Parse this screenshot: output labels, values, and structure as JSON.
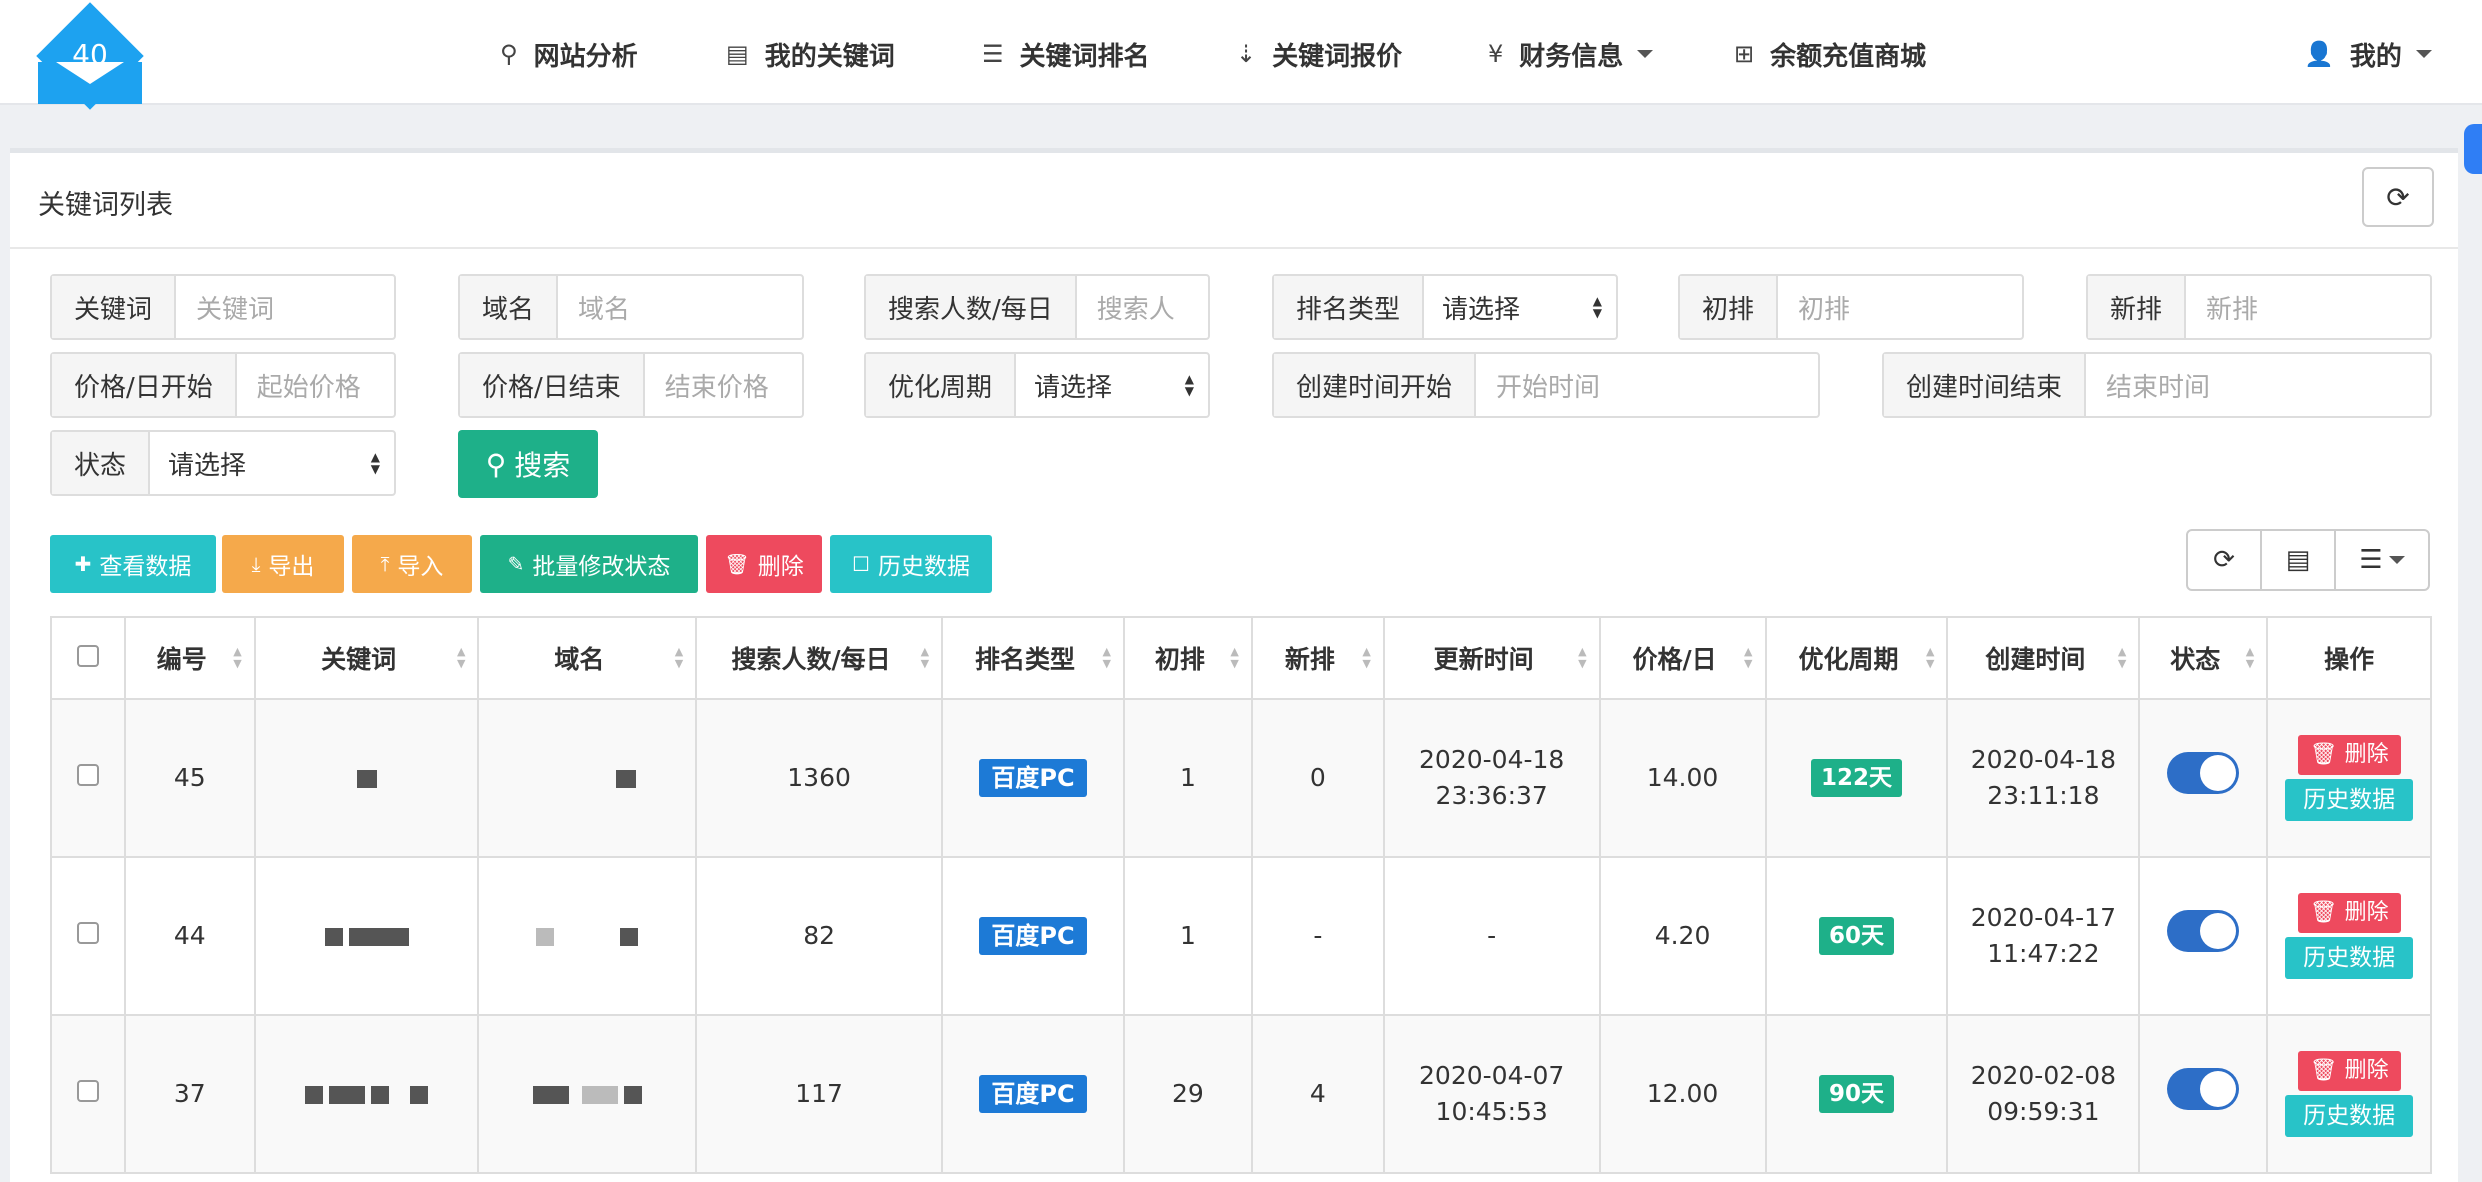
{
  "logo": {
    "badge": "40"
  },
  "nav": {
    "items": [
      {
        "icon": "search-icon",
        "glyph": "⚲",
        "label": "网站分析"
      },
      {
        "icon": "list-alt-icon",
        "glyph": "▤",
        "label": "我的关键词"
      },
      {
        "icon": "list-ol-icon",
        "glyph": "☰",
        "label": "关键词排名"
      },
      {
        "icon": "sort-numeric-icon",
        "glyph": "⇣",
        "label": "关键词报价"
      },
      {
        "icon": "yen-icon",
        "glyph": "¥",
        "label": "财务信息"
      },
      {
        "icon": "plus-square-icon",
        "glyph": "⊞",
        "label": "余额充值商城"
      }
    ],
    "user_label": "我的"
  },
  "panel": {
    "title": "关键词列表"
  },
  "filters": {
    "keyword": {
      "label": "关键词",
      "placeholder": "关键词"
    },
    "domain": {
      "label": "域名",
      "placeholder": "域名"
    },
    "searches": {
      "label": "搜索人数/每日",
      "placeholder": "搜索人"
    },
    "rank_type": {
      "label": "排名类型",
      "value": "请选择"
    },
    "first_rank": {
      "label": "初排",
      "placeholder": "初排"
    },
    "new_rank": {
      "label": "新排",
      "placeholder": "新排"
    },
    "price_start": {
      "label": "价格/日开始",
      "placeholder": "起始价格"
    },
    "price_end": {
      "label": "价格/日结束",
      "placeholder": "结束价格"
    },
    "period": {
      "label": "优化周期",
      "value": "请选择"
    },
    "created_start": {
      "label": "创建时间开始",
      "placeholder": "开始时间"
    },
    "created_end": {
      "label": "创建时间结束",
      "placeholder": "结束时间"
    },
    "status": {
      "label": "状态",
      "value": "请选择"
    },
    "search_button": "搜索"
  },
  "toolbar": {
    "view": "查看数据",
    "export": "导出",
    "import": "导入",
    "batch": "批量修改状态",
    "delete": "删除",
    "history": "历史数据"
  },
  "colors": {
    "accent_green": "#1eb089",
    "accent_cyan": "#28c3c8",
    "accent_orange": "#f5a94b",
    "accent_red": "#ee4a5e",
    "badge_blue": "#1d7ad6",
    "logo_blue": "#1da2f0"
  },
  "table": {
    "headers": [
      "编号",
      "关键词",
      "域名",
      "搜索人数/每日",
      "排名类型",
      "初排",
      "新排",
      "更新时间",
      "价格/日",
      "优化周期",
      "创建时间",
      "状态",
      "操作"
    ],
    "rows": [
      {
        "id": "45",
        "searches": "1360",
        "rank_type": "百度PC",
        "first": "1",
        "new": "0",
        "updated_date": "2020-04-18",
        "updated_time": "23:36:37",
        "price": "14.00",
        "period": "122天",
        "created_date": "2020-04-18",
        "created_time": "23:11:18",
        "status": "on",
        "del": "删除",
        "history": "历史数据"
      },
      {
        "id": "44",
        "searches": "82",
        "rank_type": "百度PC",
        "first": "1",
        "new": "-",
        "updated_date": "-",
        "updated_time": "",
        "price": "4.20",
        "period": "60天",
        "created_date": "2020-04-17",
        "created_time": "11:47:22",
        "status": "on",
        "del": "删除",
        "history": "历史数据"
      },
      {
        "id": "37",
        "searches": "117",
        "rank_type": "百度PC",
        "first": "29",
        "new": "4",
        "updated_date": "2020-04-07",
        "updated_time": "10:45:53",
        "price": "12.00",
        "period": "90天",
        "created_date": "2020-02-08",
        "created_time": "09:59:31",
        "status": "on",
        "del": "删除",
        "history": "历史数据"
      }
    ]
  }
}
